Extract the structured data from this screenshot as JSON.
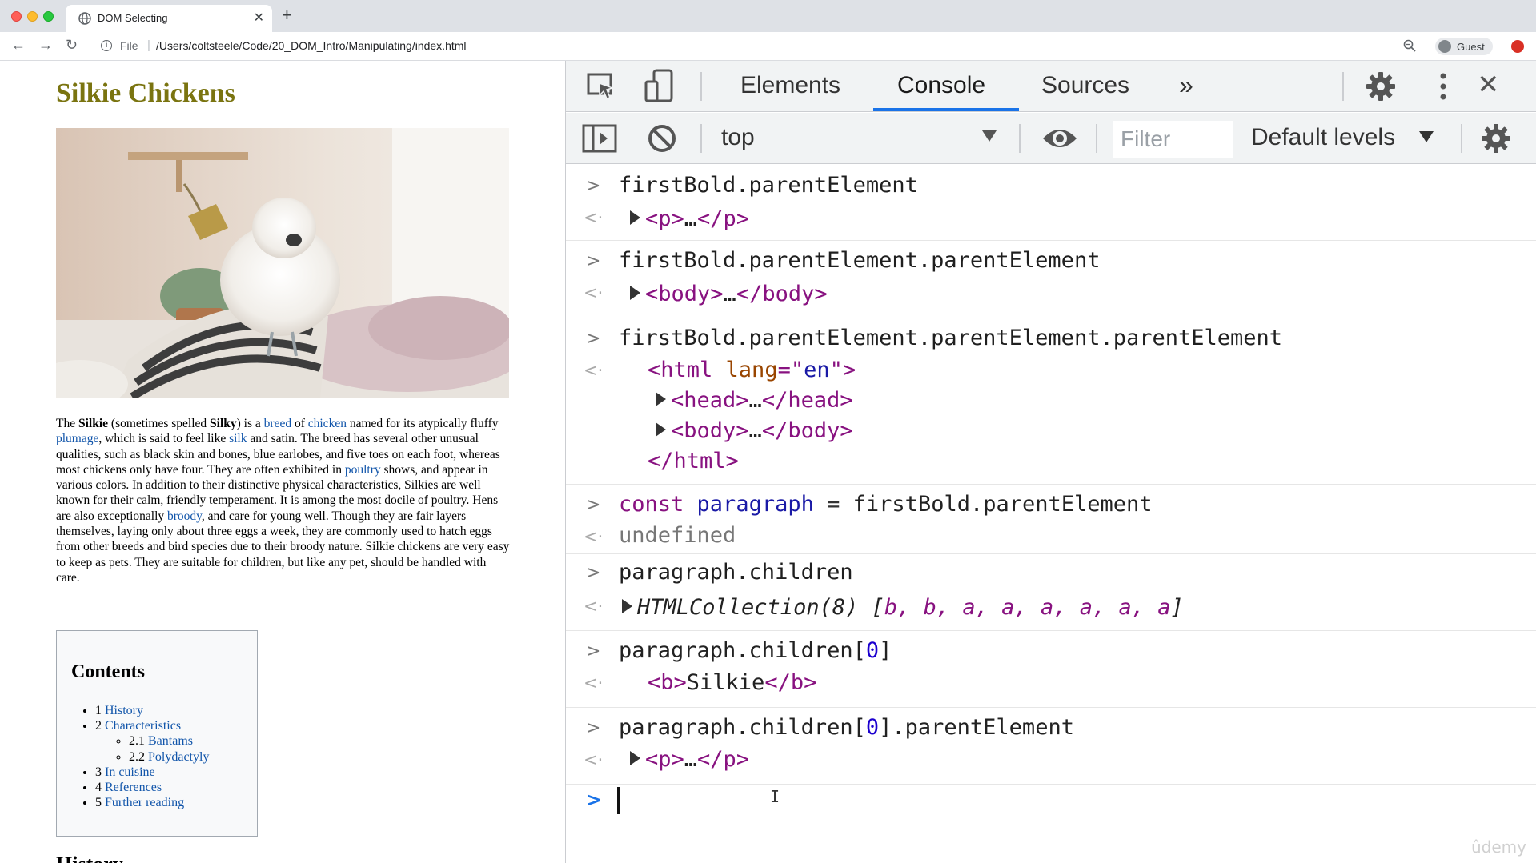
{
  "browser": {
    "tab_title": "DOM Selecting",
    "tab_close": "✕",
    "new_tab": "+",
    "url_scheme_label": "File",
    "url_separator": "|",
    "url_path": "/Users/coltsteele/Code/20_DOM_Intro/Manipulating/index.html",
    "profile_label": "Guest",
    "nav_back": "←",
    "nav_forward": "→",
    "nav_reload": "↻"
  },
  "page": {
    "title": "Silkie Chickens",
    "article": {
      "the": "The ",
      "silkie": "Silkie",
      "t1": " (sometimes spelled ",
      "silky": "Silky",
      "t2": ") is a ",
      "breed": "breed",
      "t3": " of ",
      "chicken": "chicken",
      "t4": " named for its atypically fluffy ",
      "plumage": "plumage",
      "t5": ", which is said to feel like ",
      "silk": "silk",
      "t6": " and satin. The breed has several other unusual qualities, such as black skin and bones, blue earlobes, and five toes on each foot, whereas most chickens only have four. They are often exhibited in ",
      "poultry": "poultry",
      "t7": " shows, and appear in various colors. In addition to their distinctive physical characteristics, Silkies are well known for their calm, friendly temperament. It is among the most docile of poultry. Hens are also exceptionally ",
      "broody": "broody",
      "t8": ", and care for young well. Though they are fair layers themselves, laying only about three eggs a week, they are commonly used to hatch eggs from other breeds and bird species due to their broody nature. Silkie chickens are very easy to keep as pets. They are suitable for children, but like any pet, should be handled with care."
    },
    "toc": {
      "title": "Contents",
      "items": [
        {
          "num": "1",
          "label": "History"
        },
        {
          "num": "2",
          "label": "Characteristics"
        },
        {
          "num": "2.1",
          "label": "Bantams"
        },
        {
          "num": "2.2",
          "label": "Polydactyly"
        },
        {
          "num": "3",
          "label": "In cuisine"
        },
        {
          "num": "4",
          "label": "References"
        },
        {
          "num": "5",
          "label": "Further reading"
        }
      ]
    },
    "next_heading": "History"
  },
  "devtools": {
    "tabs": [
      "Elements",
      "Console",
      "Sources"
    ],
    "more": "»",
    "close": "✕",
    "context": "top",
    "filter_placeholder": "Filter",
    "levels": "Default levels",
    "console": {
      "e1_in": "firstBold.parentElement",
      "e1_out_open": "<p>",
      "e1_out_ell": "…",
      "e1_out_close": "</p>",
      "e2_in": "firstBold.parentElement.parentElement",
      "e2_out_open": "<body>",
      "e2_out_ell": "…",
      "e2_out_close": "</body>",
      "e3_in": "firstBold.parentElement.parentElement.parentElement",
      "e3_html_open": "<html ",
      "e3_attr_name": "lang",
      "e3_attr_eq": "=\"",
      "e3_attr_val": "en",
      "e3_attr_end": "\">",
      "e3_head_open": "<head>",
      "e3_head_ell": "…",
      "e3_head_close": "</head>",
      "e3_body_open": "<body>",
      "e3_body_ell": "…",
      "e3_body_close": "</body>",
      "e3_html_close": "</html>",
      "e4_kw": "const",
      "e4_var": "paragraph",
      "e4_op": "=",
      "e4_rhs": "firstBold.parentElement",
      "e4_out": "undefined",
      "e5_in": "paragraph.children",
      "e5_coll": "HTMLCollection(8)",
      "e5_open": "[",
      "e5_items": "b, b, a, a, a, a, a, a",
      "e5_close": "]",
      "e6_in_a": "paragraph.children[",
      "e6_num": "0",
      "e6_in_b": "]",
      "e6_out_open": "<b>",
      "e6_out_text": "Silkie",
      "e6_out_close": "</b>",
      "e7_in_a": "paragraph.children[",
      "e7_num": "0",
      "e7_in_b": "].parentElement",
      "e7_out_open": "<p>",
      "e7_out_ell": "…",
      "e7_out_close": "</p>"
    }
  },
  "watermark": "ûdemy",
  "colors": {
    "accent": "#1a73e8",
    "title_olive": "#7a7410",
    "link": "#1155aa",
    "tag_purple": "#881280"
  }
}
